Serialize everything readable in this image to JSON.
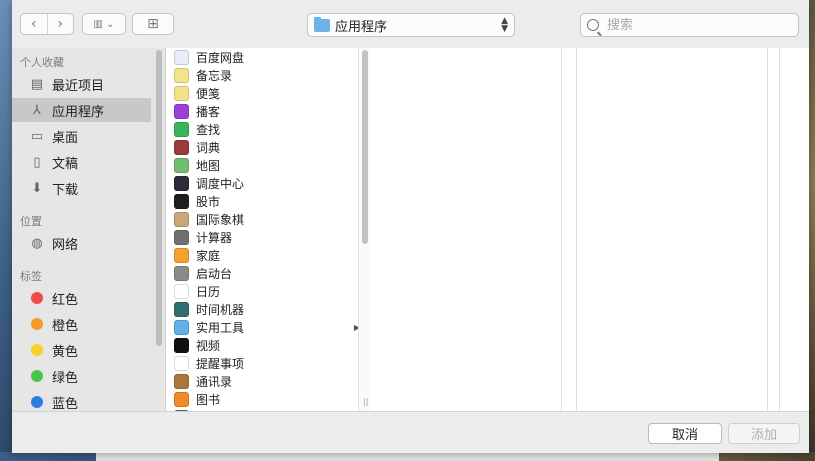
{
  "toolbar": {
    "back_icon": "‹",
    "forward_icon": "›",
    "view_icon": "▥ ⌄",
    "new_folder_icon": "⊞",
    "location": "应用程序",
    "search_placeholder": "搜索"
  },
  "sidebar": {
    "sections": {
      "favorites": "个人收藏",
      "locations": "位置",
      "tags": "标签"
    },
    "favorites": [
      {
        "label": "最近项目",
        "icon": "▤"
      },
      {
        "label": "应用程序",
        "icon": "⅄",
        "selected": true
      },
      {
        "label": "桌面",
        "icon": "▭"
      },
      {
        "label": "文稿",
        "icon": "▯"
      },
      {
        "label": "下载",
        "icon": "⬇"
      }
    ],
    "locations": [
      {
        "label": "网络",
        "icon": "◍"
      }
    ],
    "tags": [
      {
        "label": "红色",
        "color": "#f24a4a"
      },
      {
        "label": "橙色",
        "color": "#f49a2a"
      },
      {
        "label": "黄色",
        "color": "#f7d02c"
      },
      {
        "label": "绿色",
        "color": "#4ac34a"
      },
      {
        "label": "蓝色",
        "color": "#2f7de2"
      }
    ]
  },
  "files": [
    {
      "name": "百度网盘",
      "color": "#e6eef8"
    },
    {
      "name": "备忘录",
      "color": "#f4e48a"
    },
    {
      "name": "便笺",
      "color": "#f3e28a"
    },
    {
      "name": "播客",
      "color": "#9b3fd8"
    },
    {
      "name": "查找",
      "color": "#3bb35a"
    },
    {
      "name": "词典",
      "color": "#9a3a3a"
    },
    {
      "name": "地图",
      "color": "#6fbf6a"
    },
    {
      "name": "调度中心",
      "color": "#2b2b3a"
    },
    {
      "name": "股市",
      "color": "#1e1e1e"
    },
    {
      "name": "国际象棋",
      "color": "#c9a77a"
    },
    {
      "name": "计算器",
      "color": "#707070"
    },
    {
      "name": "家庭",
      "color": "#f4a22e"
    },
    {
      "name": "启动台",
      "color": "#8a8a8a"
    },
    {
      "name": "日历",
      "color": "#ffffff"
    },
    {
      "name": "时间机器",
      "color": "#2f6f6f"
    },
    {
      "name": "实用工具",
      "color": "#5fb3e6",
      "folder": true
    },
    {
      "name": "视频",
      "color": "#111111"
    },
    {
      "name": "提醒事项",
      "color": "#ffffff"
    },
    {
      "name": "通讯录",
      "color": "#a8783a"
    },
    {
      "name": "图书",
      "color": "#f08a2a"
    },
    {
      "name": "图像捕捉",
      "color": "#6a6a6a"
    }
  ],
  "folder_arrow": "▶",
  "column_grip": "||",
  "footer": {
    "cancel": "取消",
    "add": "添加"
  }
}
